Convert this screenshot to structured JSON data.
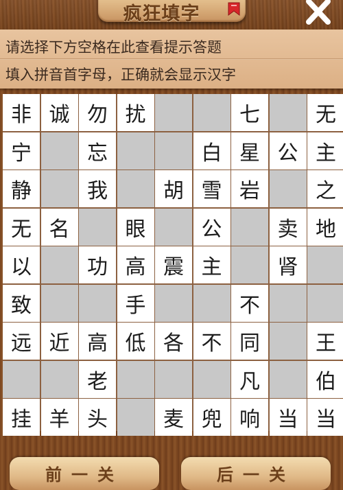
{
  "header": {
    "title": "疯狂填字",
    "ribbon_icon": "ribbon-badge-icon",
    "close_icon": "close-icon"
  },
  "hints": {
    "line1": "请选择下方空格在此查看提示答题",
    "line2": "填入拼音首字母，正确就会显示汉字"
  },
  "board": {
    "rows": [
      [
        "非",
        "诚",
        "勿",
        "扰",
        "",
        "",
        "七",
        "",
        "无"
      ],
      [
        "宁",
        "",
        "忘",
        "",
        "",
        "白",
        "星",
        "公",
        "主"
      ],
      [
        "静",
        "",
        "我",
        "",
        "胡",
        "雪",
        "岩",
        "",
        "之"
      ],
      [
        "无",
        "名",
        "",
        "眼",
        "",
        "公",
        "",
        "卖",
        "地"
      ],
      [
        "以",
        "",
        "功",
        "高",
        "震",
        "主",
        "",
        "肾",
        ""
      ],
      [
        "致",
        "",
        "",
        "手",
        "",
        "",
        "不",
        "",
        ""
      ],
      [
        "远",
        "近",
        "高",
        "低",
        "各",
        "不",
        "同",
        "",
        "王"
      ],
      [
        "",
        "",
        "老",
        "",
        "",
        "",
        "凡",
        "",
        "伯"
      ],
      [
        "挂",
        "羊",
        "头",
        "",
        "麦",
        "兜",
        "响",
        "当",
        "当"
      ]
    ]
  },
  "footer": {
    "prev_label": "前一关",
    "next_label": "后一关"
  }
}
